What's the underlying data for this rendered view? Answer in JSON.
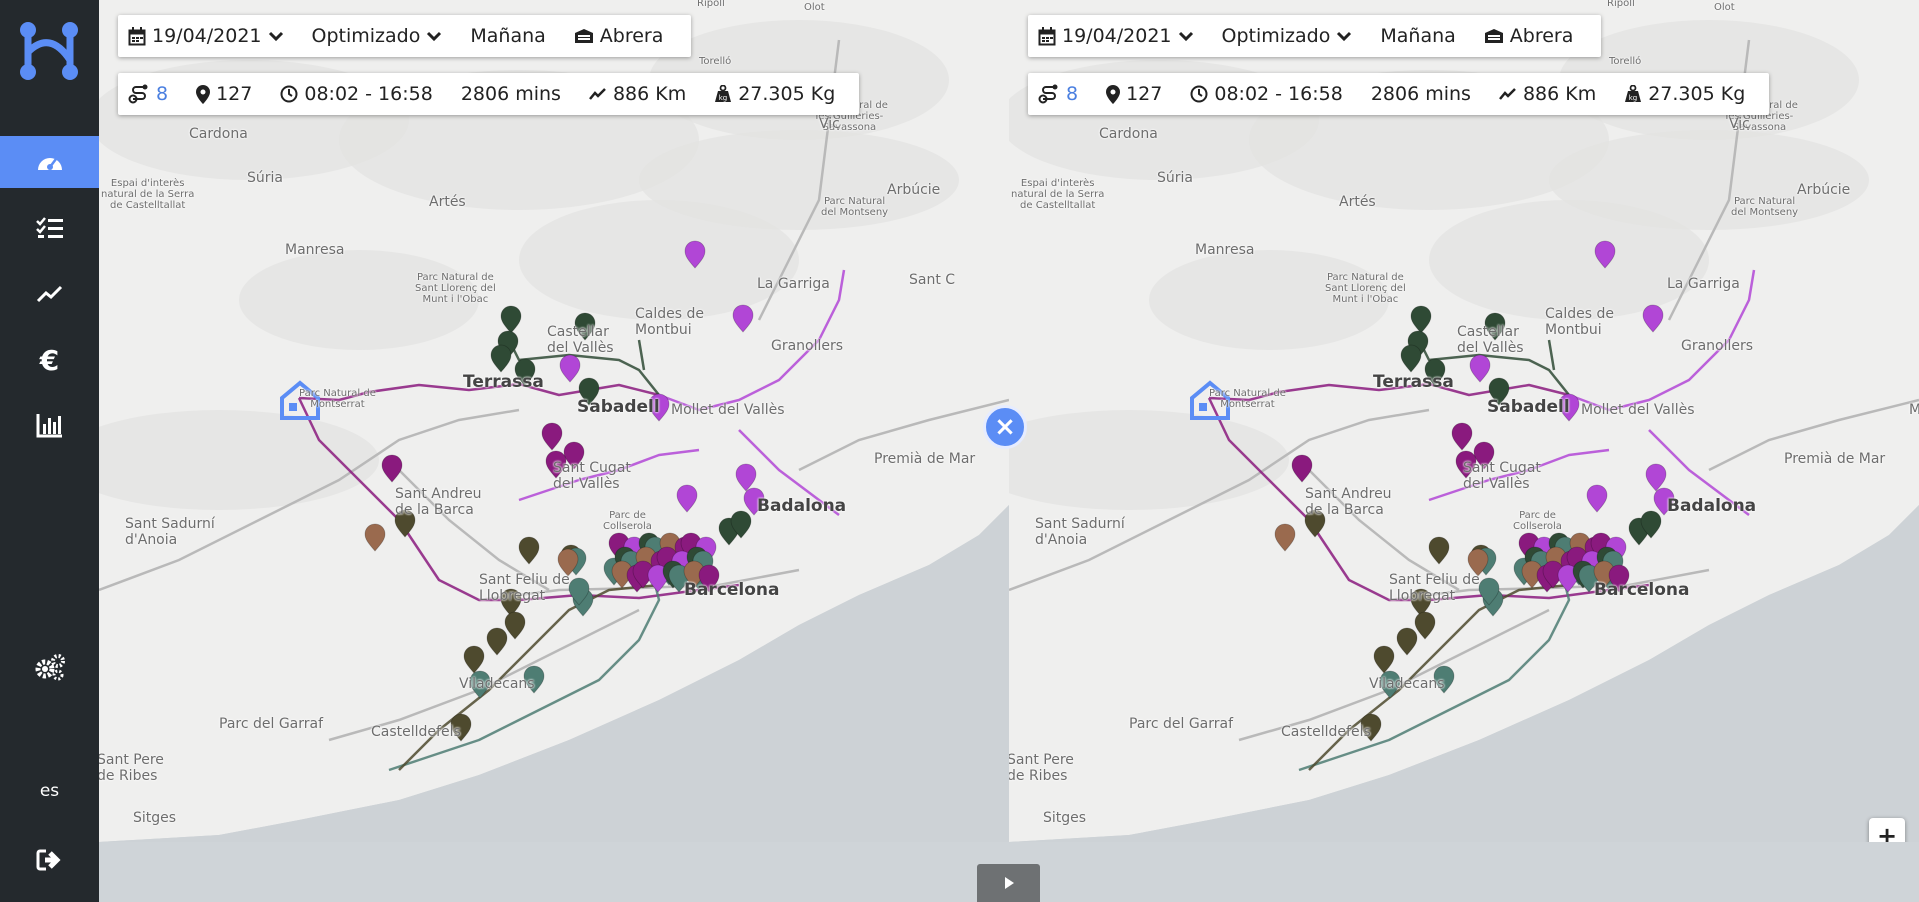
{
  "sidebar": {
    "logo_icon": "route-logo-icon",
    "items": [
      {
        "icon": "dashboard-icon",
        "active": true
      },
      {
        "icon": "checklist-icon"
      },
      {
        "icon": "trend-icon"
      },
      {
        "icon": "euro-icon",
        "label": "€"
      },
      {
        "icon": "bar-chart-icon"
      },
      {
        "icon": "settings-icon"
      }
    ],
    "language": "es",
    "logout_icon": "logout-icon"
  },
  "panels": {
    "left": {
      "filters": {
        "date": "19/04/2021",
        "mode": "Optimizado",
        "shift": "Mañana",
        "depot": "Abrera"
      },
      "stats": {
        "routes": "8",
        "stops": "127",
        "time_window": "08:02 - 16:58",
        "duration": "2806 mins",
        "distance": "886 Km",
        "weight": "27.305 Kg"
      }
    },
    "right": {
      "filters": {
        "date": "19/04/2021",
        "mode": "Optimizado",
        "shift": "Mañana",
        "depot": "Abrera"
      },
      "stats": {
        "routes": "8",
        "stops": "127",
        "time_window": "08:02 - 16:58",
        "duration": "2806 mins",
        "distance": "886 Km",
        "weight": "27.305 Kg"
      }
    }
  },
  "map_labels": {
    "olot": "Olot",
    "ripoll": "Ripoll",
    "torello": "Torelló",
    "guilleries": "Parc Natural de\nles Guilleries-\nSavassona",
    "vic": "Vic",
    "cardona": "Cardona",
    "serra_castelltallat": "Espai d'interès\nnatural de la Serra\nde Castelltallat",
    "suria": "Súria",
    "artes": "Artés",
    "arbucies": "Arbúcie",
    "montseny": "Parc Natural\ndel Montseny",
    "manresa": "Manresa",
    "sant_llorenc": "Parc Natural de\nSant Llorenç del\nMunt i l'Obac",
    "caldes": "Caldes de\nMontbui",
    "la_garriga": "La Garriga",
    "sant_c": "Sant C",
    "castellar": "Castellar\ndel Vallès",
    "granollers": "Granollers",
    "terrassa": "Terrassa",
    "sabadell": "Sabadell",
    "mollet": "Mollet del Vallès",
    "montserrat": "Parc Natural de\nMontserrat",
    "ma": "Ma",
    "premia": "Premià de Mar",
    "sant_cugat": "Sant Cugat\ndel Vallès",
    "sant_andreu": "Sant Andreu\nde la Barca",
    "sant_sadurni": "Sant Sadurní\nd'Anoia",
    "badalona": "Badalona",
    "collserola": "Parc de\nCollserola",
    "sant_feliu": "Sant Feliu de\nLlobregat",
    "barcelona": "Barcelona",
    "viladecans": "Viladecans",
    "garraf": "Parc del Garraf",
    "castelldefels": "Castelldefels",
    "sant_pere": "Sant Pere\nde Ribes",
    "sitges": "Sitges"
  },
  "route_colors": {
    "purple": "#8a1a7e",
    "violet": "#b146d6",
    "dark_green": "#2f4a35",
    "teal": "#4e7d73",
    "olive": "#4e4a2e",
    "brown": "#9a6a4e",
    "depot": "#5b8df5",
    "accent": "#5b8df5"
  },
  "controls": {
    "swap_icon": "close-icon",
    "swap_label": "×",
    "play_icon": "play-icon",
    "zoom_in": "+",
    "zoom_out": "−"
  }
}
